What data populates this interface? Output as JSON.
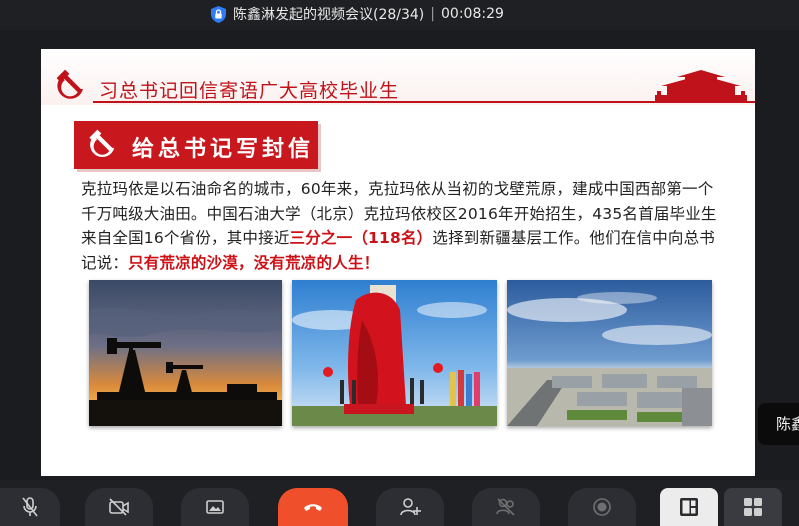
{
  "window": {
    "title": "陈鑫淋发起的视频会议(28/34)",
    "separator": "|",
    "timer": "00:08:29"
  },
  "slide": {
    "header_title": "习总书记回信寄语广大高校毕业生",
    "banner_text": "给总书记写封信",
    "body": {
      "p1": "克拉玛依是以石油命名的城市，60年来，克拉玛依从当初的戈壁荒原，建成中国西部第一个千万吨级大油田。中国石油大学（北京）克拉玛依校区2016年开始招生，435名首届毕业生来自全国16个省份，其中接近",
      "highlight1": "三分之一（118名）",
      "p2": "选择到新疆基层工作。他们在信中向总书记说：",
      "highlight2": "只有荒凉的沙漠，没有荒凉的人生！"
    }
  },
  "side_tag": "陈鑫",
  "colors": {
    "accent_red": "#c0121a",
    "hangup": "#f04f2b"
  },
  "toolbar": {
    "icons": [
      "mic-muted-icon",
      "camera-off-icon",
      "share-screen-icon",
      "hang-up-icon",
      "add-participant-icon",
      "participants-icon",
      "record-icon",
      "layout-speaker-icon",
      "layout-grid-icon"
    ]
  }
}
